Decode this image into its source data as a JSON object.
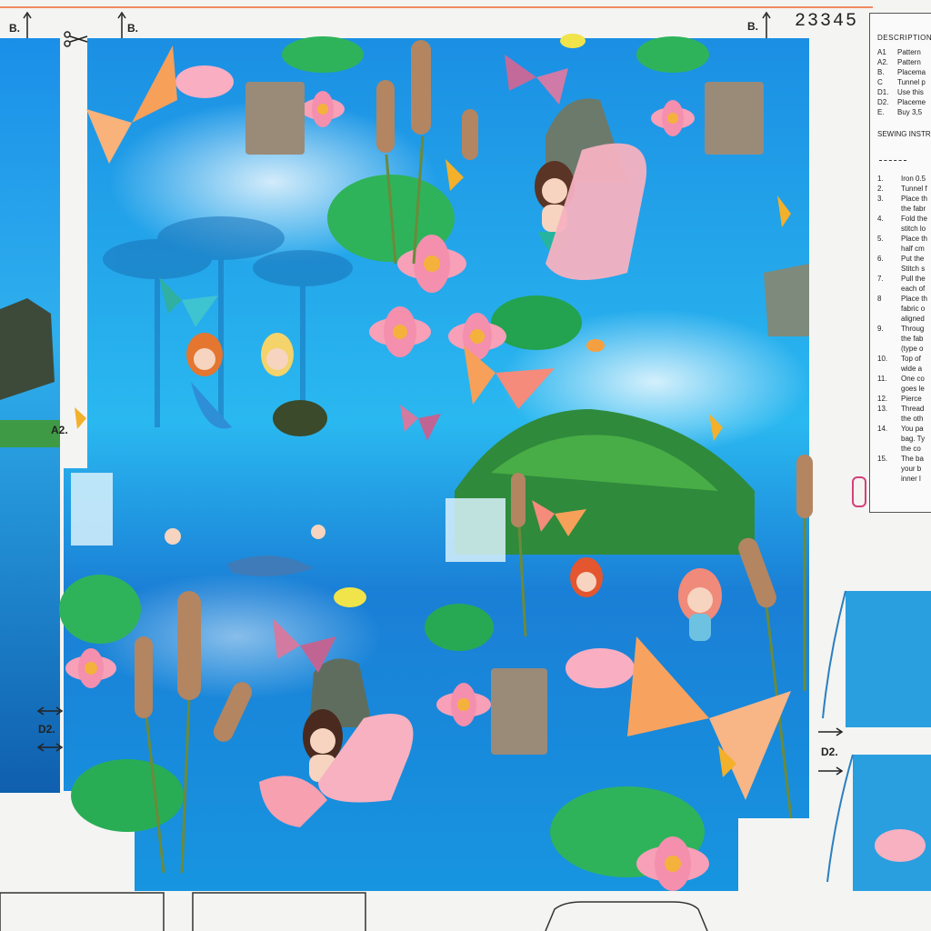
{
  "sheet": {
    "pattern_number": "23345",
    "labels": {
      "b_left": "B.",
      "b_mid": "B.",
      "b_right": "B.",
      "a2": "A2.",
      "d2_left": "D2.",
      "d2_right": "D2."
    }
  },
  "description_panel": {
    "title": "DESCRIPTION",
    "items": [
      {
        "key": "A1",
        "text": "Pattern"
      },
      {
        "key": "A2.",
        "text": "Pattern"
      },
      {
        "key": "B.",
        "text": "Placema"
      },
      {
        "key": "C",
        "text": "Tunnel p"
      },
      {
        "key": "D1.",
        "text": "Use this"
      },
      {
        "key": "D2.",
        "text": "Placeme"
      },
      {
        "key": "E.",
        "text": "Buy 3,5"
      }
    ],
    "sewing_title": "SEWING INSTR",
    "steps": [
      {
        "key": "1.",
        "text": "Iron 0.5"
      },
      {
        "key": "2.",
        "text": "Tunnel f"
      },
      {
        "key": "3.",
        "text": "Place th"
      },
      {
        "key": "",
        "text": "the fabr"
      },
      {
        "key": "4.",
        "text": "Fold the"
      },
      {
        "key": "",
        "text": "stitch lo"
      },
      {
        "key": "5.",
        "text": "Place th"
      },
      {
        "key": "",
        "text": "half cm"
      },
      {
        "key": "6.",
        "text": "Put the"
      },
      {
        "key": "",
        "text": "Stitch s"
      },
      {
        "key": "7.",
        "text": "Pull the"
      },
      {
        "key": "",
        "text": "each of"
      },
      {
        "key": "8",
        "text": "Place th"
      },
      {
        "key": "",
        "text": "fabric o"
      },
      {
        "key": "",
        "text": "aligned"
      },
      {
        "key": "9.",
        "text": "Throug"
      },
      {
        "key": "",
        "text": "the fab"
      },
      {
        "key": "",
        "text": "(type o"
      },
      {
        "key": "10.",
        "text": "Top of"
      },
      {
        "key": "",
        "text": "wide a"
      },
      {
        "key": "11.",
        "text": "One co"
      },
      {
        "key": "",
        "text": "goes le"
      },
      {
        "key": "12.",
        "text": "Pierce"
      },
      {
        "key": "13.",
        "text": "Thread"
      },
      {
        "key": "",
        "text": "the oth"
      },
      {
        "key": "14.",
        "text": "You pa"
      },
      {
        "key": "",
        "text": "bag. Ty"
      },
      {
        "key": "",
        "text": "the co"
      },
      {
        "key": "15.",
        "text": "The ba"
      },
      {
        "key": "",
        "text": "your b"
      },
      {
        "key": "",
        "text": "inner l"
      }
    ]
  },
  "colors": {
    "water": "#1fa3e6",
    "deep_water": "#1566c4",
    "lily_pink": "#f7a0b8",
    "leaf_green": "#2fb35a",
    "paper": "#f4f4f2"
  }
}
